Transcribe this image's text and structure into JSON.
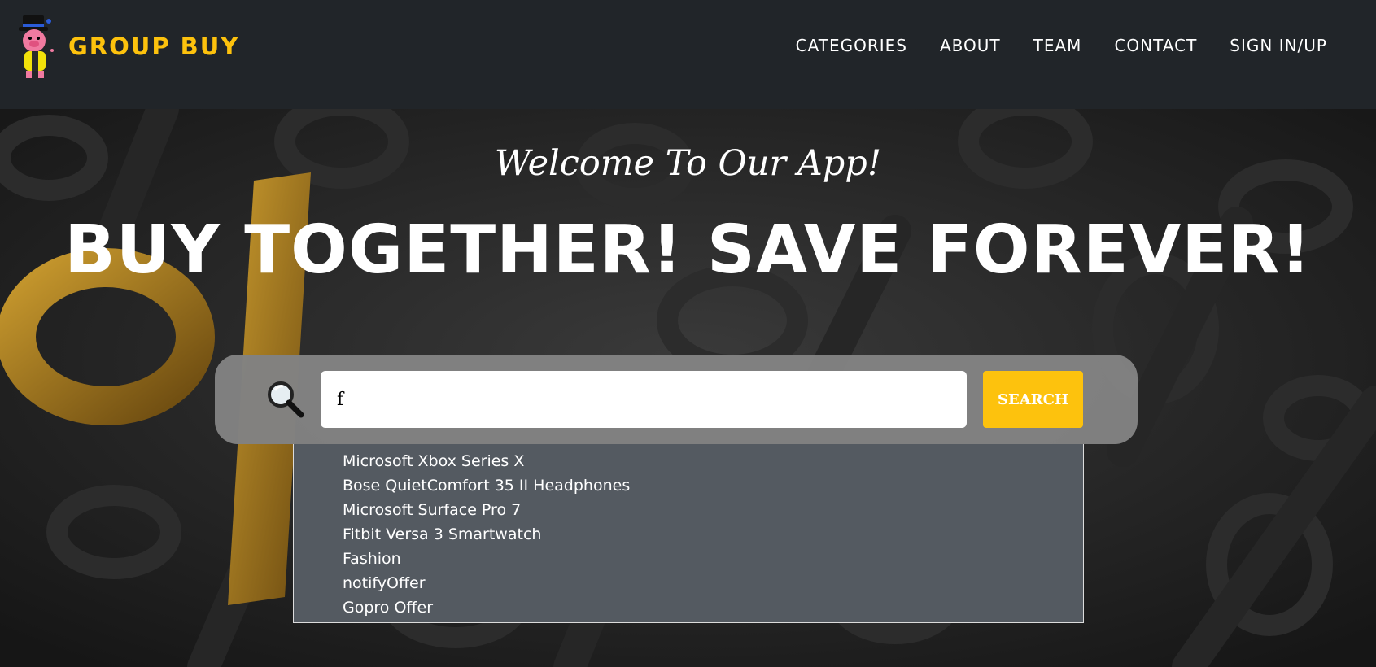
{
  "brand": {
    "name": "GROUP BUY",
    "logo": "pig-mascot-logo",
    "accent_color": "#fdc20d"
  },
  "nav": [
    {
      "label": "CATEGORIES"
    },
    {
      "label": "ABOUT"
    },
    {
      "label": "TEAM"
    },
    {
      "label": "CONTACT"
    },
    {
      "label": "SIGN IN/UP"
    }
  ],
  "hero": {
    "welcome": "Welcome To Our App!",
    "headline": "BUY TOGETHER! SAVE FOREVER!",
    "background": "percent-signs-pattern"
  },
  "search": {
    "icon": "magnifier-icon",
    "value": "f",
    "button_label": "SEARCH",
    "suggestions": [
      "Microsoft Xbox Series X",
      "Bose QuietComfort 35 II Headphones",
      "Microsoft Surface Pro 7",
      "Fitbit Versa 3 Smartwatch",
      "Fashion",
      "notifyOffer",
      "Gopro Offer"
    ]
  }
}
